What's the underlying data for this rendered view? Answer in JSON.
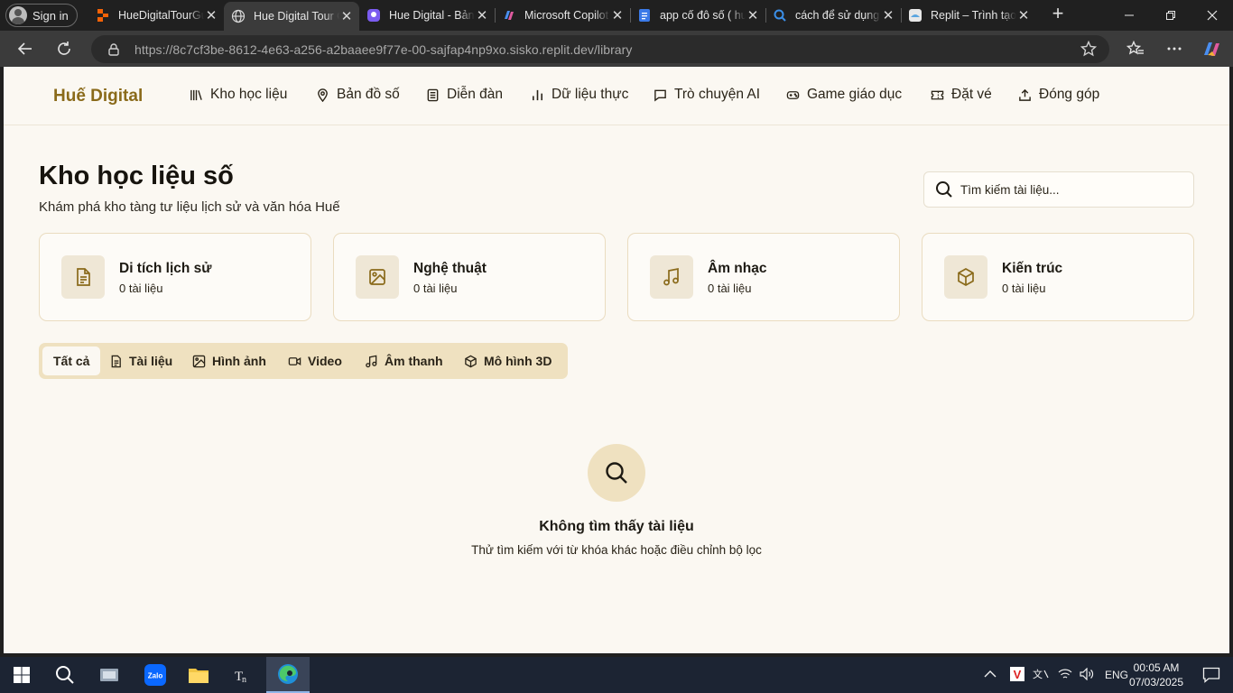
{
  "browser": {
    "signin_label": "Sign in",
    "tabs": [
      {
        "title": "HueDigitalTourGuide",
        "favicon": "replit-orange-icon",
        "color": "#f26207"
      },
      {
        "title": "Hue Digital Tour Guide",
        "favicon": "globe-icon",
        "color": "#cfcfcf"
      },
      {
        "title": "Hue Digital - Bản đồ số",
        "favicon": "app-purple-icon",
        "color": "#7b5cf0"
      },
      {
        "title": "Microsoft Copilot",
        "favicon": "copilot-icon",
        "color": "#e05a9f"
      },
      {
        "title": "app cố đô số ( hướng dẫn )",
        "favicon": "docs-icon",
        "color": "#3b7ae8"
      },
      {
        "title": "cách để sử dụng replit",
        "favicon": "search-icon",
        "color": "#3b8fe8"
      },
      {
        "title": "Replit – Trình tạo ứng dụng",
        "favicon": "replit-icon",
        "color": "#5aa5e0"
      }
    ],
    "url_host": "https://8c7cf3be-8612-4e63-a256-a2baaee9f77e-00-sajfap4np9xo.sisko.replit.dev",
    "url_path": "/library"
  },
  "site": {
    "brand": "Huế Digital",
    "nav": [
      {
        "label": "Kho học liệu",
        "icon": "library-icon"
      },
      {
        "label": "Bản đồ số",
        "icon": "map-pin-icon"
      },
      {
        "label": "Diễn đàn",
        "icon": "forum-doc-icon"
      },
      {
        "label": "Dữ liệu thực",
        "icon": "bar-chart-icon"
      },
      {
        "label": "Trò chuyện AI",
        "icon": "chat-icon"
      },
      {
        "label": "Game giáo dục",
        "icon": "gamepad-icon"
      },
      {
        "label": "Đặt vé",
        "icon": "ticket-icon"
      },
      {
        "label": "Đóng góp",
        "icon": "upload-icon"
      }
    ]
  },
  "library": {
    "title": "Kho học liệu số",
    "subtitle": "Khám phá kho tàng tư liệu lịch sử và văn hóa Huế",
    "search_placeholder": "Tìm kiếm tài liệu...",
    "categories": [
      {
        "name": "Di tích lịch sử",
        "count": "0 tài liệu",
        "icon": "document-icon"
      },
      {
        "name": "Nghệ thuật",
        "count": "0 tài liệu",
        "icon": "image-icon"
      },
      {
        "name": "Âm nhạc",
        "count": "0 tài liệu",
        "icon": "music-icon"
      },
      {
        "name": "Kiến trúc",
        "count": "0 tài liệu",
        "icon": "cube-icon"
      }
    ],
    "filters": [
      {
        "label": "Tất cả",
        "active": true
      },
      {
        "label": "Tài liệu",
        "icon": "document-icon"
      },
      {
        "label": "Hình ảnh",
        "icon": "image-icon"
      },
      {
        "label": "Video",
        "icon": "video-icon"
      },
      {
        "label": "Âm thanh",
        "icon": "music-icon"
      },
      {
        "label": "Mô hình 3D",
        "icon": "cube-icon"
      }
    ],
    "empty_title": "Không tìm thấy tài liệu",
    "empty_subtitle": "Thử tìm kiếm với từ khóa khác hoặc điều chỉnh bộ lọc"
  },
  "taskbar": {
    "language": "ENG",
    "time": "00:05 AM",
    "date": "07/03/2025"
  },
  "colors": {
    "brand": "#8a6a1a",
    "accent_icon": "#8a6a1a",
    "page_bg": "#fbf8f2",
    "filter_bg": "#efe1c0"
  }
}
